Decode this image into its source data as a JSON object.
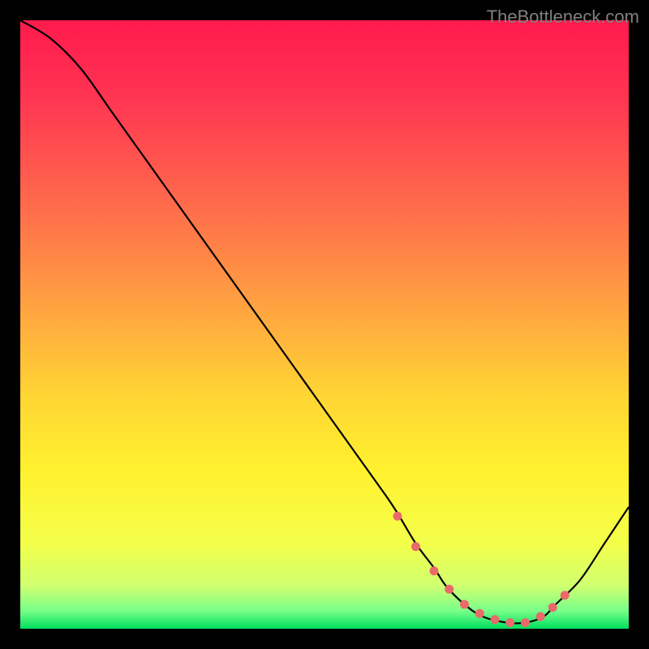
{
  "watermark": "TheBottleneck.com",
  "chart_data": {
    "type": "line",
    "title": "",
    "xlabel": "",
    "ylabel": "",
    "xlim": [
      0,
      100
    ],
    "ylim": [
      0,
      100
    ],
    "series": [
      {
        "name": "curve",
        "x": [
          0,
          5,
          10,
          15,
          20,
          25,
          30,
          35,
          40,
          45,
          50,
          55,
          60,
          62,
          65,
          68,
          70,
          73,
          76,
          80,
          83,
          86,
          88,
          92,
          96,
          100
        ],
        "y": [
          100,
          97,
          92,
          85,
          78,
          71,
          64,
          57,
          50,
          43,
          36,
          29,
          22,
          19,
          14,
          10,
          7,
          4,
          2,
          1,
          1,
          2,
          4,
          8,
          14,
          20
        ]
      }
    ],
    "markers": {
      "name": "dots",
      "x": [
        62,
        65,
        68,
        70.5,
        73,
        75.5,
        78,
        80.5,
        83,
        85.5,
        87.5,
        89.5
      ],
      "y": [
        18.5,
        13.5,
        9.5,
        6.5,
        4,
        2.5,
        1.5,
        1,
        1,
        2,
        3.5,
        5.5
      ]
    },
    "gradient_stops": [
      {
        "offset": 0.0,
        "color": "#ff1a4d"
      },
      {
        "offset": 0.12,
        "color": "#ff3352"
      },
      {
        "offset": 0.25,
        "color": "#ff5a4e"
      },
      {
        "offset": 0.38,
        "color": "#ff8447"
      },
      {
        "offset": 0.5,
        "color": "#ffad3e"
      },
      {
        "offset": 0.62,
        "color": "#ffd633"
      },
      {
        "offset": 0.74,
        "color": "#fff12e"
      },
      {
        "offset": 0.86,
        "color": "#f4ff4a"
      },
      {
        "offset": 0.93,
        "color": "#cfff70"
      },
      {
        "offset": 0.97,
        "color": "#7aff8a"
      },
      {
        "offset": 1.0,
        "color": "#00e060"
      }
    ],
    "dot_color": "#e86a6a",
    "line_color": "#000000"
  }
}
